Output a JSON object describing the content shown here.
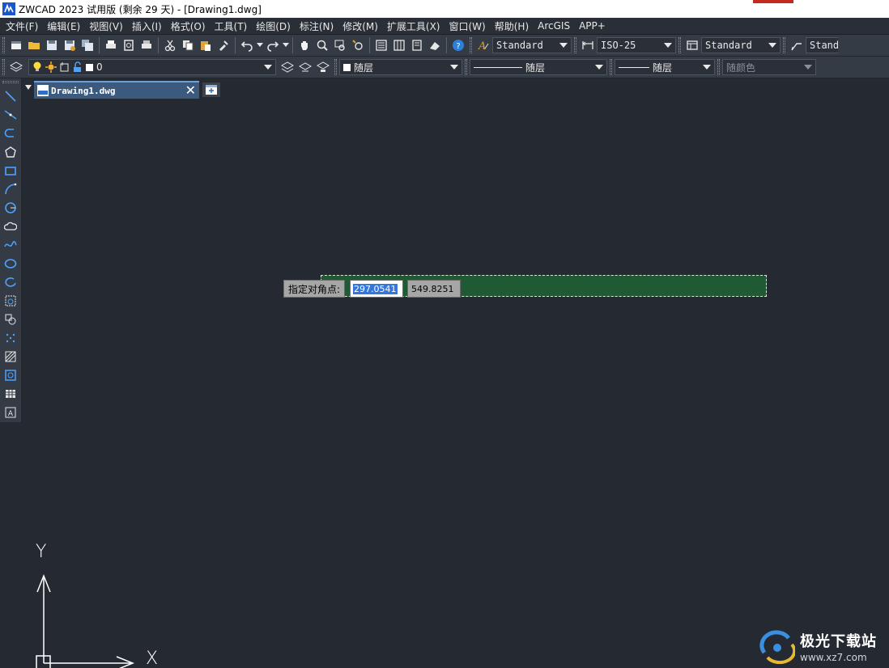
{
  "window": {
    "title": "ZWCAD 2023 试用版 (剩余 29 天) - [Drawing1.dwg]"
  },
  "menu": {
    "items": [
      {
        "label": "文件(F)"
      },
      {
        "label": "编辑(E)"
      },
      {
        "label": "视图(V)"
      },
      {
        "label": "插入(I)"
      },
      {
        "label": "格式(O)"
      },
      {
        "label": "工具(T)"
      },
      {
        "label": "绘图(D)"
      },
      {
        "label": "标注(N)"
      },
      {
        "label": "修改(M)"
      },
      {
        "label": "扩展工具(X)"
      },
      {
        "label": "窗口(W)"
      },
      {
        "label": "帮助(H)"
      },
      {
        "label": "ArcGIS"
      },
      {
        "label": "APP+"
      }
    ]
  },
  "toolbar1": {
    "text_style": "Standard",
    "dim_style": "ISO-25",
    "table_style": "Standard",
    "mleader_style": "Standa"
  },
  "toolbar2": {
    "layer_name": "0",
    "color": "随层",
    "linetype": "随层",
    "lineweight": "随层",
    "plot_style": "随颜色"
  },
  "tabs": {
    "document_label": "Drawing1.dwg",
    "close_glyph": "✕"
  },
  "prompt": {
    "label": "指定对角点:",
    "x_value": "297.0541",
    "y_value": "549.8251"
  },
  "ucs": {
    "x_label": "X",
    "y_label": "Y"
  },
  "watermark": {
    "name": "极光下载站",
    "url": "www.xz7.com"
  },
  "colors": {
    "canvas_bg": "#252a32",
    "toolbar_bg": "#353b45",
    "selection_fill": "#1f5a34",
    "active_tab": "#3c5a7e",
    "accent_blue": "#3377dd"
  }
}
